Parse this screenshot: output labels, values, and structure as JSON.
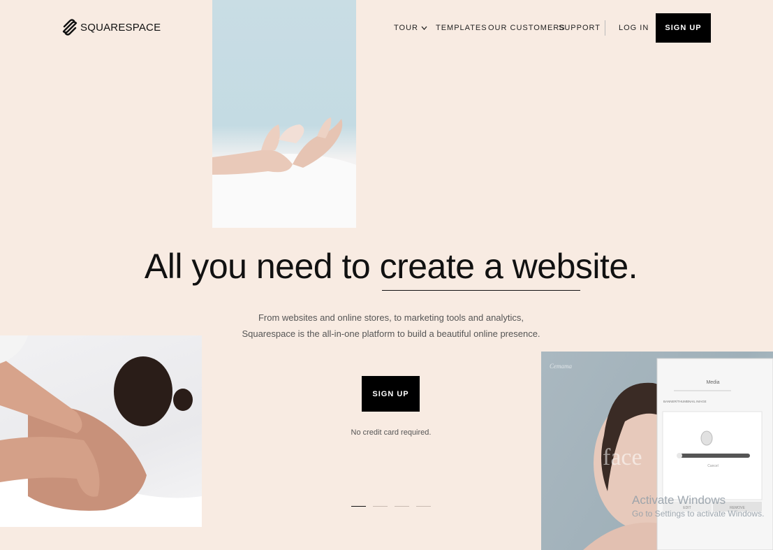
{
  "brand": {
    "name": "SQUARESPACE"
  },
  "nav": {
    "tour": "TOUR",
    "templates": "TEMPLATES",
    "customers": "OUR CUSTOMERS",
    "support": "SUPPORT",
    "login": "LOG IN",
    "signup": "SIGN UP"
  },
  "hero": {
    "headline_start": "All you need to ",
    "headline_emphasis": "create a website.",
    "sub_line1": "From websites and online stores, to marketing tools and analytics,",
    "sub_line2": "Squarespace is the all-in-one platform to build a beautiful online presence.",
    "cta": "SIGN UP",
    "note": "No credit card required."
  },
  "editor_preview": {
    "site_name": "Cemama",
    "overlay_word": "face",
    "panel_title": "Media",
    "section_label": "BANNER/THUMBNAIL IMAGE",
    "cancel": "Cancel",
    "edit": "EDIT",
    "remove": "REMOVE"
  },
  "carousel": {
    "count": 4,
    "active": 0
  },
  "system_overlay": {
    "title": "Activate Windows",
    "subtitle": "Go to Settings to activate Windows."
  },
  "colors": {
    "background": "#f8ebe2",
    "button": "#000000",
    "text": "#111111"
  }
}
